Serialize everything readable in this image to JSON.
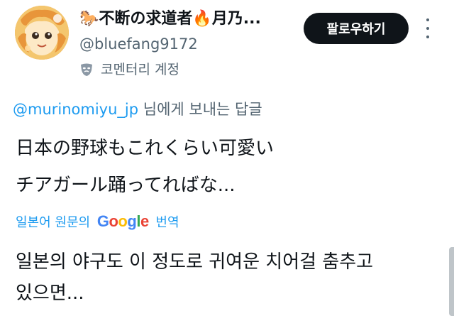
{
  "profile": {
    "display_name": "🐎不断の求道者🔥月乃...",
    "handle": "@bluefang9172",
    "account_label": "코멘터리 계정",
    "account_label_icon": "mask-icon",
    "avatar_icon": "anime-avatar"
  },
  "actions": {
    "follow_label": "팔로우하기",
    "more_icon": "more-vertical-icon"
  },
  "reply": {
    "mention": "@murinomiyu_jp",
    "suffix": " 님에게 보내는 답글"
  },
  "tweet": {
    "lines": [
      "日本の野球もこれくらい可愛い",
      "チアガール踊ってればな..."
    ]
  },
  "translation": {
    "prefix": "일본어 원문의",
    "provider": "Google",
    "suffix": "번역",
    "lines": [
      "일본의 야구도 이 정도로 귀여운 치어걸 춤추고",
      "있으면..."
    ]
  },
  "colors": {
    "link": "#1d9bf0",
    "secondary_text": "#536471",
    "primary_text": "#0f1419",
    "button_bg": "#0f1419"
  }
}
